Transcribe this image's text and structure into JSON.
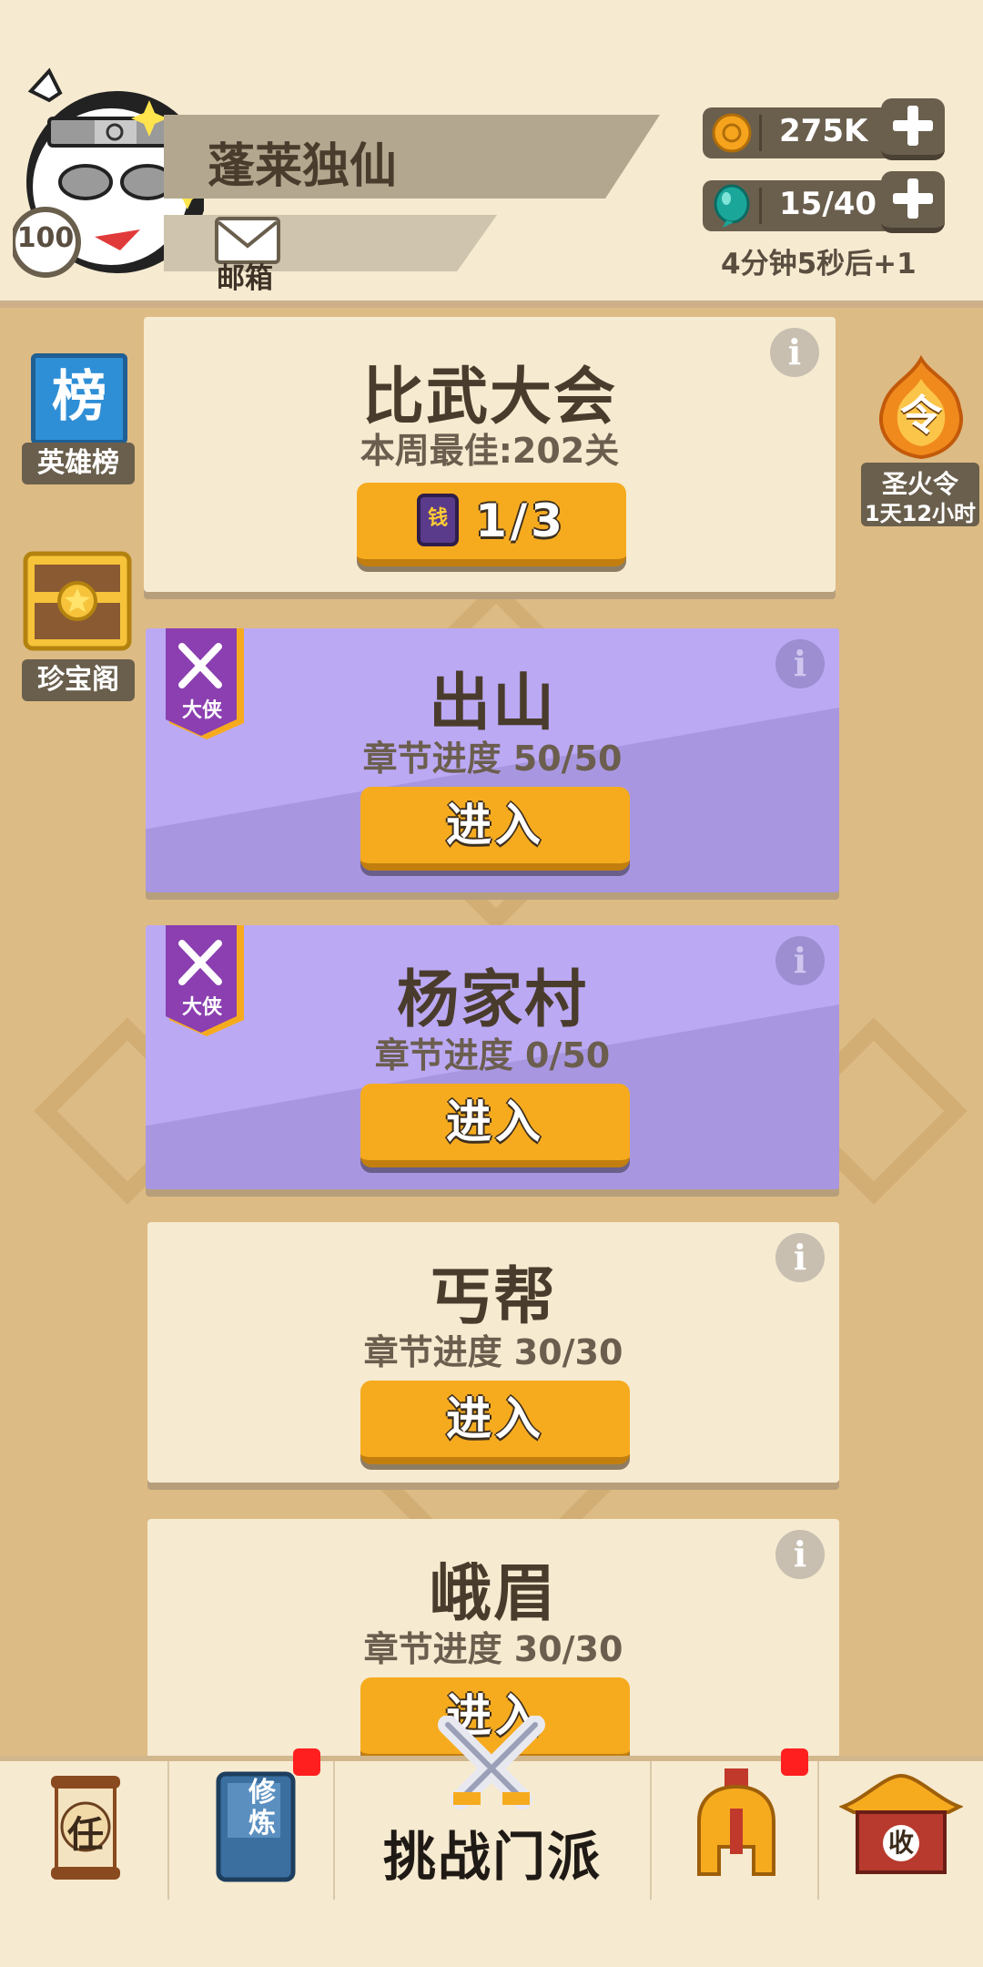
{
  "header": {
    "player_name": "蓬莱独仙",
    "level": "100",
    "mail_label": "邮箱",
    "coins": "275K",
    "stamina": "15/40",
    "stamina_timer": "4分钟5秒后+1"
  },
  "sidebar_left": {
    "leaderboard_icon_char": "榜",
    "leaderboard_label": "英雄榜",
    "treasure_label": "珍宝阁"
  },
  "sidebar_right": {
    "token_icon_char": "令",
    "token_label": "圣火令",
    "token_timer": "1天12小时"
  },
  "tournament": {
    "title": "比武大会",
    "best": "本周最佳:202关",
    "ticket_icon_char": "钱",
    "tickets": "1/3"
  },
  "chapters": [
    {
      "title": "出山",
      "progress": "章节进度 50/50",
      "button": "进入",
      "badge": "大侠",
      "style": "purple"
    },
    {
      "title": "杨家村",
      "progress": "章节进度 0/50",
      "button": "进入",
      "badge": "大侠",
      "style": "purple"
    },
    {
      "title": "丐帮",
      "progress": "章节进度 30/30",
      "button": "进入",
      "badge": "",
      "style": "cream"
    },
    {
      "title": "峨眉",
      "progress": "章节进度 30/30",
      "button": "进入",
      "badge": "",
      "style": "cream"
    }
  ],
  "info_glyph": "i",
  "bottom_nav": {
    "task_icon_char": "任",
    "cultivate_icon_text": "修炼",
    "center_label": "挑战门派",
    "collect_icon_char": "收"
  },
  "colors": {
    "background": "#ddbb84",
    "panel": "#f6ead0",
    "button": "#f6ab1f",
    "purple_card": "#bba9f4",
    "notification": "#ff1f1f"
  }
}
